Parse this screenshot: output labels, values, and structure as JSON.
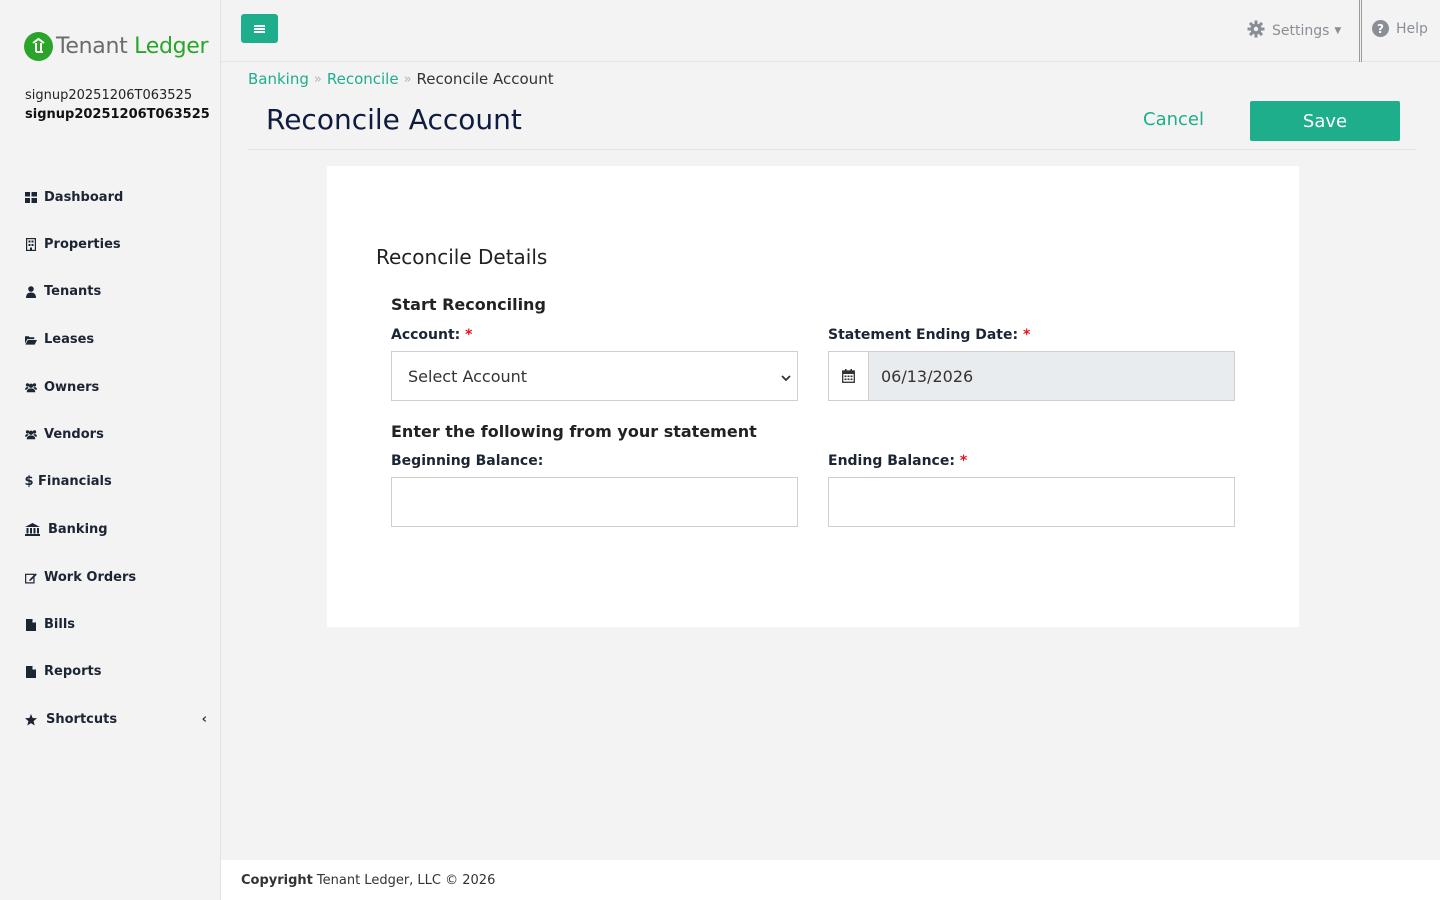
{
  "brand": {
    "name_part1": "Tenant",
    "name_part2": "Ledger",
    "accent": "#1fae8b",
    "logo_green": "#2aa52a"
  },
  "user": {
    "line1": "signup20251206T063525",
    "line2": "signup20251206T063525"
  },
  "sidebar": {
    "items": [
      {
        "label": "Dashboard",
        "icon": "dashboard-icon"
      },
      {
        "label": "Properties",
        "icon": "building-icon"
      },
      {
        "label": "Tenants",
        "icon": "user-icon"
      },
      {
        "label": "Leases",
        "icon": "folder-open-icon"
      },
      {
        "label": "Owners",
        "icon": "users-icon"
      },
      {
        "label": "Vendors",
        "icon": "users-icon"
      },
      {
        "label": "Financials",
        "icon": "dollar-icon"
      },
      {
        "label": "Banking",
        "icon": "bank-icon"
      },
      {
        "label": "Work Orders",
        "icon": "edit-icon"
      },
      {
        "label": "Bills",
        "icon": "file-icon"
      },
      {
        "label": "Reports",
        "icon": "file-icon"
      },
      {
        "label": "Shortcuts",
        "icon": "star-icon",
        "chevron": "‹"
      }
    ]
  },
  "topbar": {
    "settings_label": "Settings",
    "help_label": "Help"
  },
  "breadcrumb": {
    "item1": "Banking",
    "item2": "Reconcile",
    "current": "Reconcile Account"
  },
  "header": {
    "title": "Reconcile Account",
    "cancel_label": "Cancel",
    "save_label": "Save"
  },
  "form": {
    "section_title": "Reconcile Details",
    "start_heading": "Start Reconciling",
    "account_label": "Account:",
    "account_value": "Select Account",
    "date_label": "Statement Ending Date:",
    "date_value": "06/13/2026",
    "statement_heading": "Enter the following from your statement",
    "beginning_label": "Beginning Balance:",
    "beginning_value": "",
    "ending_label": "Ending Balance:",
    "ending_value": "",
    "required_mark": "*"
  },
  "footer": {
    "copyright_bold": "Copyright",
    "copyright_text": "Tenant Ledger, LLC © 2026"
  }
}
